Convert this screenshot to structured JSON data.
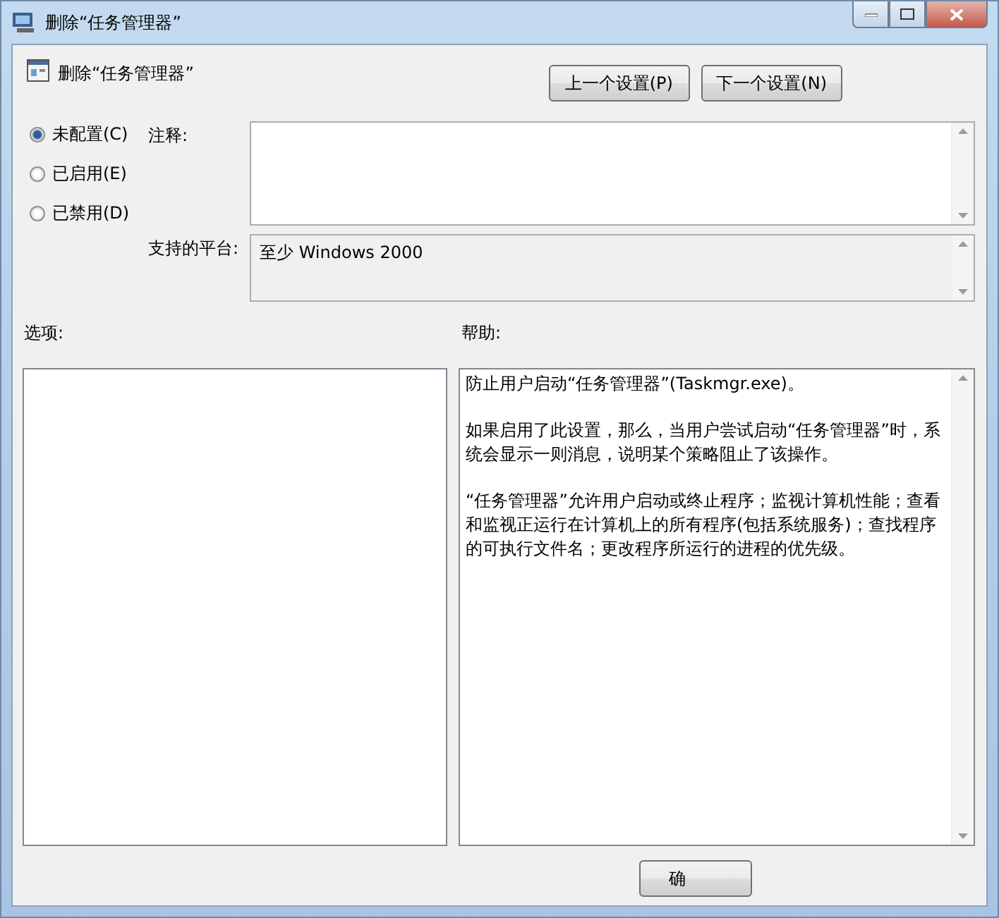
{
  "window": {
    "title": "删除“任务管理器”"
  },
  "header": {
    "title": "删除“任务管理器”",
    "buttons": [
      "上一个设置(P)",
      "下一个设置(N)"
    ]
  },
  "options": [
    {
      "label": "未配置(C)",
      "selected": true
    },
    {
      "label": "已启用(E)",
      "selected": false
    },
    {
      "label": "已禁用(D)",
      "selected": false
    }
  ],
  "comment": {
    "label": "注释:"
  },
  "platform": {
    "label": "支持的平台:",
    "value": "至少 Windows 2000"
  },
  "options_panel": {
    "label": "选项:"
  },
  "help_panel": {
    "label": "帮助:",
    "paragraphs": [
      "防止用户启动“任务管理器”(Taskmgr.exe)。",
      "如果启用了此设置，那么，当用户尝试启动“任务管理器”时，系统会显示一则消息，说明某个策略阻止了该操作。",
      "“任务管理器”允许用户启动或终止程序；监视计算机性能；查看和监视正运行在计算机上的所有程序(包括系统服务)；查找程序的可执行文件名；更改程序所运行的进程的优先级。"
    ]
  },
  "footer": {
    "buttons": [
      "确"
    ]
  }
}
